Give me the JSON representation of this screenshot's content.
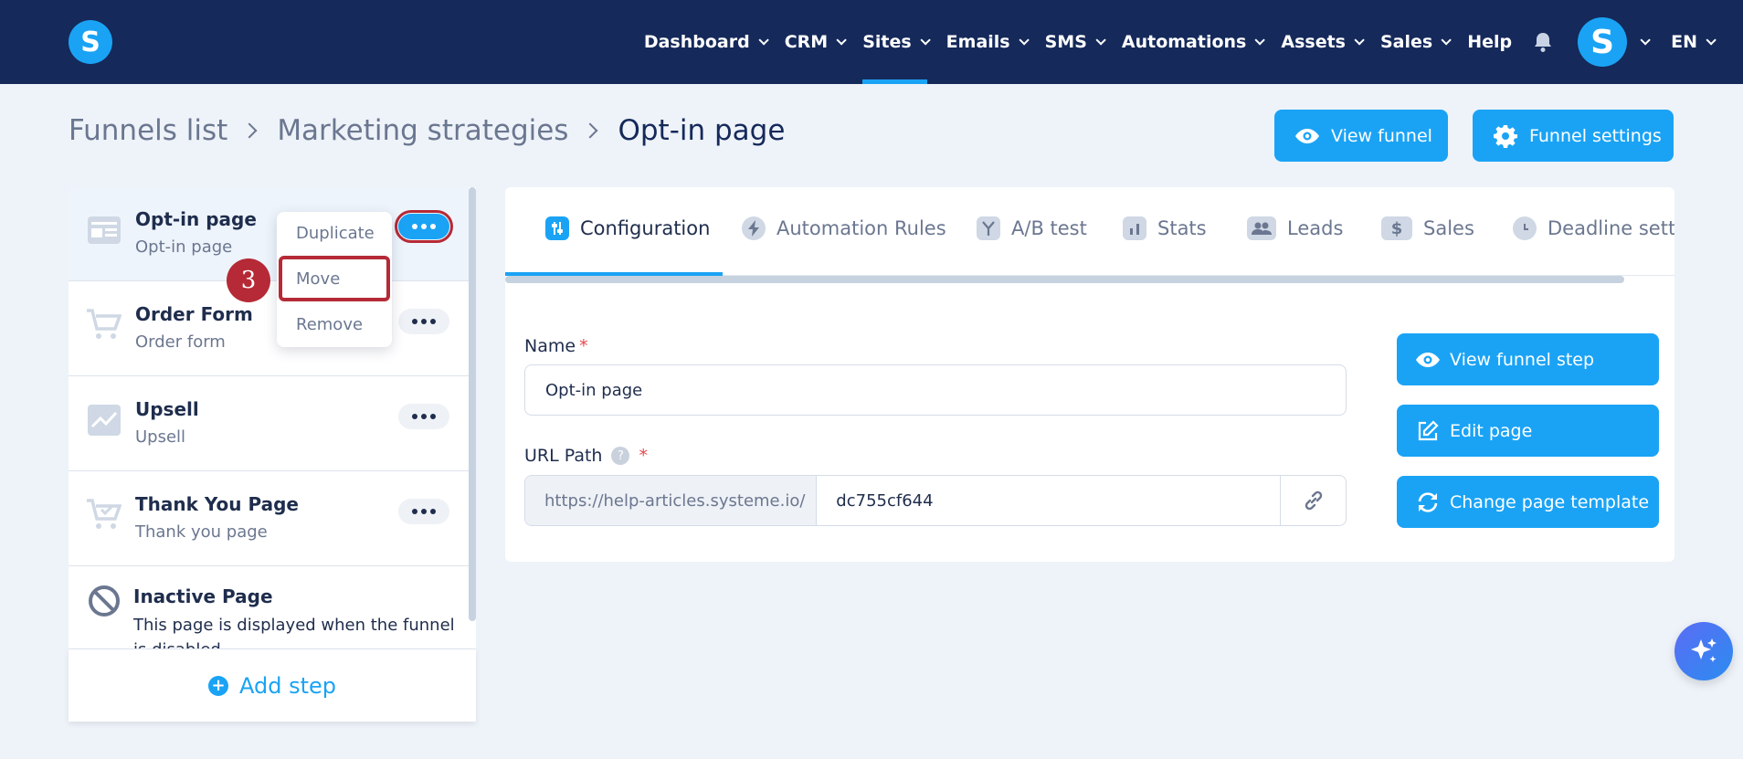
{
  "app": {
    "logo_letter": "S",
    "accent": "#1aa3f5",
    "navbar_bg": "#15295a",
    "highlight": "#b52a36"
  },
  "nav": {
    "items": [
      {
        "label": "Dashboard"
      },
      {
        "label": "CRM"
      },
      {
        "label": "Sites"
      },
      {
        "label": "Emails"
      },
      {
        "label": "SMS"
      },
      {
        "label": "Automations"
      },
      {
        "label": "Assets"
      },
      {
        "label": "Sales"
      }
    ],
    "active": "Sites",
    "help": "Help",
    "avatar_letter": "S",
    "language": "EN"
  },
  "breadcrumb": {
    "items": [
      "Funnels list",
      "Marketing strategies"
    ],
    "current": "Opt-in page"
  },
  "header_buttons": {
    "view_funnel": "View funnel",
    "funnel_settings": "Funnel settings"
  },
  "steps": [
    {
      "title": "Opt-in page",
      "subtitle": "Opt-in page",
      "icon": "page-layout-icon"
    },
    {
      "title": "Order Form",
      "subtitle": "Order form",
      "icon": "cart-icon"
    },
    {
      "title": "Upsell",
      "subtitle": "Upsell",
      "icon": "trending-up-icon"
    },
    {
      "title": "Thank You Page",
      "subtitle": "Thank you page",
      "icon": "cart-check-icon"
    },
    {
      "title": "Inactive Page",
      "subtitle": "This page is displayed when the funnel is disabled",
      "icon": "ban-icon"
    }
  ],
  "add_step": "Add step",
  "dropdown": {
    "items": [
      "Duplicate",
      "Move",
      "Remove"
    ],
    "highlighted": "Move",
    "step_badge": "3"
  },
  "tabs": [
    {
      "label": "Configuration",
      "icon": "sliders-icon"
    },
    {
      "label": "Automation Rules",
      "icon": "lightning-icon"
    },
    {
      "label": "A/B test",
      "icon": "split-icon"
    },
    {
      "label": "Stats",
      "icon": "bar-chart-icon"
    },
    {
      "label": "Leads",
      "icon": "users-icon"
    },
    {
      "label": "Sales",
      "icon": "dollar-icon"
    },
    {
      "label": "Deadline setti",
      "icon": "clock-icon"
    }
  ],
  "form": {
    "name_label": "Name",
    "required_mark": "*",
    "name_value": "Opt-in page",
    "url_label": "URL Path",
    "help_mark": "?",
    "url_prefix": "https://help-articles.systeme.io/",
    "url_slug": "dc755cf644"
  },
  "side_buttons": {
    "view_step": "View funnel step",
    "edit_page": "Edit page",
    "change_template": "Change page template"
  }
}
